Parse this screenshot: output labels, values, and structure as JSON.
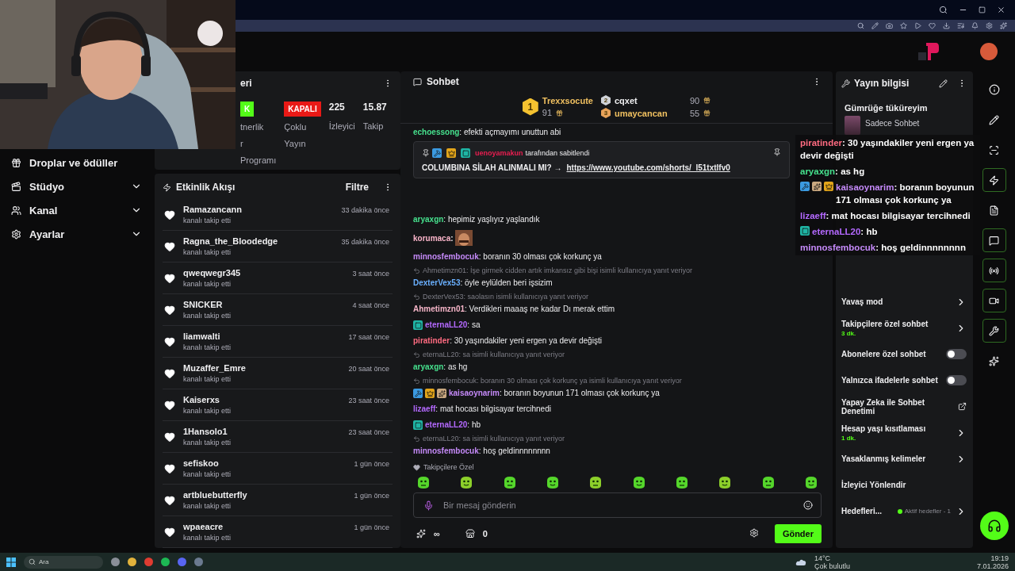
{
  "sidebar": {
    "items": [
      {
        "label": "Droplar ve ödüller",
        "expandable": false
      },
      {
        "label": "Stüdyo",
        "expandable": true
      },
      {
        "label": "Kanal",
        "expandable": true
      },
      {
        "label": "Ayarlar",
        "expandable": true
      }
    ]
  },
  "stats": {
    "title": "eri",
    "items": [
      {
        "kind": "badge",
        "value": "K",
        "color": "#53fc18",
        "label": [
          "tnerlik",
          "r",
          "Programı"
        ]
      },
      {
        "kind": "badge",
        "value": "KAPALI",
        "color": "#e91916",
        "label": [
          "Çoklu",
          "Yayın"
        ]
      },
      {
        "kind": "number",
        "value": "225",
        "label": [
          "İzleyici"
        ]
      },
      {
        "kind": "number",
        "value": "15.87",
        "label": [
          "Takip"
        ]
      }
    ]
  },
  "activity": {
    "title": "Etkinlik Akışı",
    "filter": "Filtre",
    "events": [
      {
        "name": "Ramazancann",
        "action": "kanalı takip etti",
        "time": "33 dakika önce"
      },
      {
        "name": "Ragna_the_Bloodedge",
        "action": "kanalı takip etti",
        "time": "35 dakika önce"
      },
      {
        "name": "qweqwegr345",
        "action": "kanalı takip etti",
        "time": "3 saat önce"
      },
      {
        "name": "SNICKER",
        "action": "kanalı takip etti",
        "time": "4 saat önce"
      },
      {
        "name": "liamwalti",
        "action": "kanalı takip etti",
        "time": "17 saat önce"
      },
      {
        "name": "Muzaffer_Emre",
        "action": "kanalı takip etti",
        "time": "20 saat önce"
      },
      {
        "name": "Kaiserxs",
        "action": "kanalı takip etti",
        "time": "23 saat önce"
      },
      {
        "name": "1Hansolo1",
        "action": "kanalı takip etti",
        "time": "23 saat önce"
      },
      {
        "name": "sefiskoo",
        "action": "kanalı takip etti",
        "time": "1 gün önce"
      },
      {
        "name": "artbluebutterfly",
        "action": "kanalı takip etti",
        "time": "1 gün önce"
      },
      {
        "name": "wpaeacre",
        "action": "kanalı takip etti",
        "time": "1 gün önce"
      }
    ]
  },
  "chat": {
    "title": "Sohbet",
    "leaderboard": [
      {
        "rank": "1",
        "name": "Trexxsocute",
        "score": "91"
      },
      {
        "rank": "2",
        "name": "cqxet",
        "score": "90"
      },
      {
        "rank": "3",
        "name": "umaycancan",
        "score": "55"
      }
    ],
    "behind_pinned": {
      "user": "echoessong",
      "color": "#46e08d",
      "text": ": efekti açmayımı unuttun abi"
    },
    "pinned": {
      "badges": [
        {
          "kind": "mod"
        },
        {
          "kind": "crown"
        },
        {
          "kind": "og"
        }
      ],
      "by": "uenoyamakun",
      "color": "#e91e50",
      "note": "tarafından sabitlendi",
      "text": "COLUMBINA SİLAH ALINMALI MI? →",
      "link": "https://www.youtube.com/shorts/_l51txtlfv0"
    },
    "messages": [
      {
        "kind": "text",
        "user": "aryaxgn",
        "color": "#46e08d",
        "text": ": hepimiz yaşlıyız yaşlandık"
      },
      {
        "kind": "emote",
        "user": "korumaca",
        "color": "#f9b4c9",
        "text": ":"
      },
      {
        "kind": "text",
        "user": "minnosfembocuk",
        "color": "#c58af9",
        "text": ": boranın 30 olması çok korkunç ya"
      },
      {
        "kind": "text",
        "reply": "Ahmetimzn01: İşe girmek cidden artık imkansız gibi bişi isimli kullanıcıya yanıt veriyor",
        "user": "DexterVex53",
        "color": "#6ab0ff",
        "text": ": öyle eylülden beri işsizim"
      },
      {
        "kind": "text",
        "reply": "DexterVex53: saolasın isimli kullanıcıya yanıt veriyor",
        "user": "Ahmetimzn01",
        "color": "#f7b6c9",
        "text": ": Verdikleri maaaş ne kadar Dı merak ettim"
      },
      {
        "kind": "text",
        "user": "eternaLL20",
        "color": "#b469ff",
        "badges": [
          {
            "kind": "og"
          }
        ],
        "text": ": sa"
      },
      {
        "kind": "text",
        "user": "piratinder",
        "color": "#ff6b81",
        "text": ": 30 yaşındakiler yeni ergen ya devir değişti"
      },
      {
        "kind": "text",
        "reply": "eternaLL20: sa isimli kullanıcıya yanıt veriyor",
        "user": "aryaxgn",
        "color": "#46e08d",
        "text": ": as hg"
      },
      {
        "kind": "text",
        "reply": "minnosfembocuk: boranın 30 olması çok korkunç ya isimli kullanıcıya yanıt veriyor",
        "user": "kaisaoynarim",
        "color": "#c58af9",
        "badges": [
          {
            "kind": "mod"
          },
          {
            "kind": "crown"
          },
          {
            "kind": "gift"
          }
        ],
        "text": ": boranın boyunun 171 olması çok korkunç ya"
      },
      {
        "kind": "text",
        "user": "lizaeff",
        "color": "#b469ff",
        "text": ": mat hocası bilgisayar tercihnedi"
      },
      {
        "kind": "text",
        "user": "eternaLL20",
        "color": "#b469ff",
        "badges": [
          {
            "kind": "og"
          }
        ],
        "text": ": hb"
      },
      {
        "kind": "text",
        "reply": "eternaLL20: sa isimli kullanıcıya yanıt veriyor",
        "user": "minnosfembocuk",
        "color": "#c58af9",
        "text": ": hoş geldinnnnnnnn"
      }
    ],
    "emote_section": "Takipçilere Özel",
    "input": {
      "placeholder": "Bir mesaj gönderin"
    },
    "points": "∞",
    "drops": "0",
    "send": "Gönder"
  },
  "overlay": [
    {
      "user": "piratinder",
      "color": "#ff6b81",
      "text": ": 30 yaşındakiler yeni ergen ya devir değişti"
    },
    {
      "user": "aryaxgn",
      "color": "#46e08d",
      "text": ": as hg"
    },
    {
      "user": "kaisaoynarim",
      "color": "#c58af9",
      "badges": [
        {
          "kind": "mod"
        },
        {
          "kind": "gift"
        },
        {
          "kind": "crown"
        }
      ],
      "text": ": boranın boyunun 171 olması çok korkunç ya"
    },
    {
      "user": "lizaeff",
      "color": "#b469ff",
      "text": ": mat hocası bilgisayar tercihnedi"
    },
    {
      "user": "eternaLL20",
      "color": "#b469ff",
      "badges": [
        {
          "kind": "og"
        }
      ],
      "text": ": hb"
    },
    {
      "user": "minnosfembocuk",
      "color": "#c58af9",
      "text": ": hoş geldinnnnnnnn"
    }
  ],
  "stream_info": {
    "title": "Yayın bilgisi",
    "stream_title": "Gümrüğe tüküreyim",
    "category": "Sadece Sohbet",
    "settings": [
      {
        "kind": "link",
        "label": "Yavaş mod"
      },
      {
        "kind": "link",
        "label": "Takipçilere özel sohbet",
        "sub": "3 dk."
      },
      {
        "kind": "toggle",
        "label": "Abonelere özel sohbet",
        "on": false
      },
      {
        "kind": "toggle",
        "label": "Yalnızca ifadelerle sohbet",
        "on": false
      },
      {
        "kind": "external",
        "label": "Yapay Zeka ile Sohbet Denetimi"
      },
      {
        "kind": "link",
        "label": "Hesap yaşı kısıtlaması",
        "sub": "1 dk."
      },
      {
        "kind": "link",
        "label": "Yasaklanmış kelimeler"
      },
      {
        "kind": "plain",
        "label": "İzleyici Yönlendir"
      },
      {
        "kind": "goal",
        "label": "Hedefleri...",
        "status": "Aktif hedefler - 1"
      }
    ]
  },
  "taskbar": {
    "search": "Ara",
    "temperature": "14°C",
    "weather": "Çok bulutlu",
    "time": "19:19",
    "date": "7.01.2026"
  }
}
